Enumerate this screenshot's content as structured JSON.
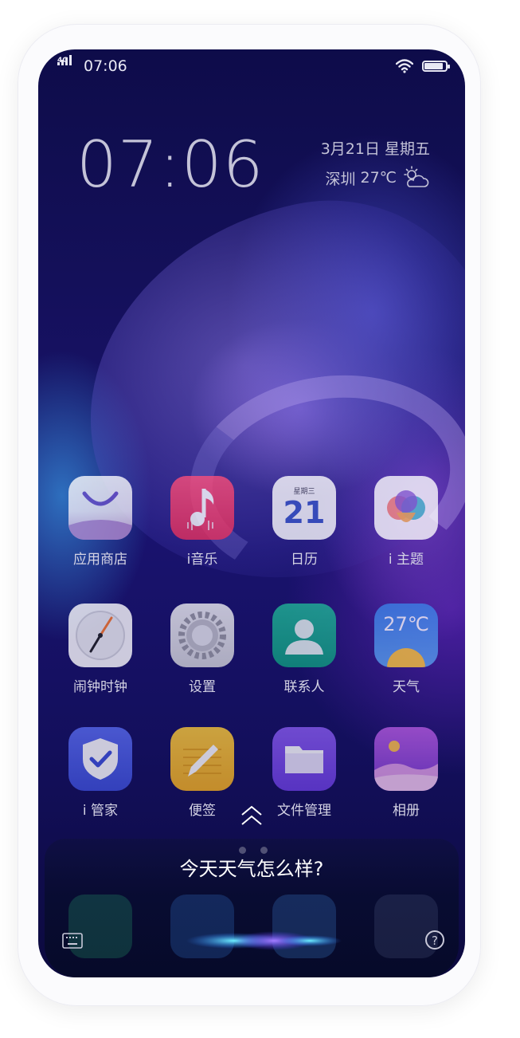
{
  "status_bar": {
    "network": "4G",
    "time": "07:06",
    "battery_level": 0.9
  },
  "lockscreen": {
    "clock": "07:06",
    "date": "3月21日  星期五",
    "city": "深圳",
    "temperature": "27℃",
    "weather_icon": "partly-cloudy-icon"
  },
  "apps": [
    {
      "label": "应用商店",
      "icon": "app-store-icon"
    },
    {
      "label": "i音乐",
      "icon": "music-icon"
    },
    {
      "label": "日历",
      "icon": "calendar-icon",
      "weekday": "星期三",
      "day": "21"
    },
    {
      "label": "i 主题",
      "icon": "theme-icon"
    },
    {
      "label": "闹钟时钟",
      "icon": "clock-icon"
    },
    {
      "label": "设置",
      "icon": "gear-icon"
    },
    {
      "label": "联系人",
      "icon": "contacts-icon"
    },
    {
      "label": "天气",
      "icon": "weather-icon",
      "temp": "27℃"
    },
    {
      "label": "i 管家",
      "icon": "shield-icon"
    },
    {
      "label": "便签",
      "icon": "notes-icon"
    },
    {
      "label": "文件管理",
      "icon": "folder-icon"
    },
    {
      "label": "相册",
      "icon": "gallery-icon"
    }
  ],
  "dock": [
    "phone-icon",
    "messages-icon",
    "browser-icon",
    "camera-icon"
  ],
  "assistant": {
    "query": "今天天气怎么样?",
    "help_label": "?"
  },
  "page_indicator": {
    "count": 2,
    "active": 0
  }
}
